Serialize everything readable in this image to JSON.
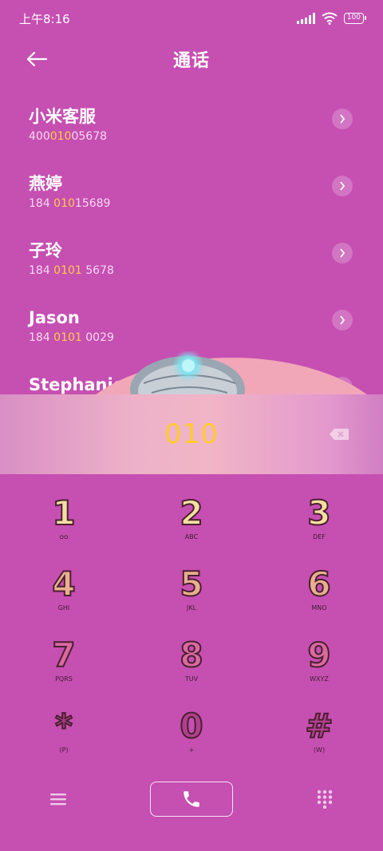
{
  "status_bar": {
    "time": "上午8:16",
    "battery": "100"
  },
  "header": {
    "title": "通话"
  },
  "contacts": [
    {
      "name": "小米客服",
      "number_pre": "400",
      "number_match": "010",
      "number_post": "05678"
    },
    {
      "name": "燕婷",
      "number_pre": "184 ",
      "number_match": "010",
      "number_post": "15689"
    },
    {
      "name": "子玲",
      "number_pre": "184 ",
      "number_match": "0101",
      "number_post": " 5678"
    },
    {
      "name": "Jason",
      "number_pre": "184 ",
      "number_match": "0101",
      "number_post": " 0029"
    },
    {
      "name": "Stephanie",
      "number_pre": "",
      "number_match": "",
      "number_post": ""
    }
  ],
  "dial": {
    "number": "010"
  },
  "keypad": [
    {
      "digit": "1",
      "letters": "ᴑᴑ",
      "tone": "yellow"
    },
    {
      "digit": "2",
      "letters": "ABC",
      "tone": "yellow"
    },
    {
      "digit": "3",
      "letters": "DEF",
      "tone": "yellow"
    },
    {
      "digit": "4",
      "letters": "GHI",
      "tone": "peach"
    },
    {
      "digit": "5",
      "letters": "JKL",
      "tone": "peach"
    },
    {
      "digit": "6",
      "letters": "MNO",
      "tone": "peach"
    },
    {
      "digit": "7",
      "letters": "PQRS",
      "tone": "pink"
    },
    {
      "digit": "8",
      "letters": "TUV",
      "tone": "pink"
    },
    {
      "digit": "9",
      "letters": "WXYZ",
      "tone": "pink"
    },
    {
      "digit": "*",
      "letters": "(P)",
      "tone": "magenta"
    },
    {
      "digit": "0",
      "letters": "+",
      "tone": "magenta"
    },
    {
      "digit": "#",
      "letters": "(W)",
      "tone": "magenta"
    }
  ],
  "colors": {
    "background": "#C64FB2",
    "highlight": "#FFCB47",
    "dial_text": "#FFCB2E"
  },
  "icons": {
    "back": "arrow-left-icon",
    "call": "phone-icon",
    "menu": "hamburger-icon",
    "dialpad": "dialpad-icon",
    "backspace": "backspace-icon"
  }
}
